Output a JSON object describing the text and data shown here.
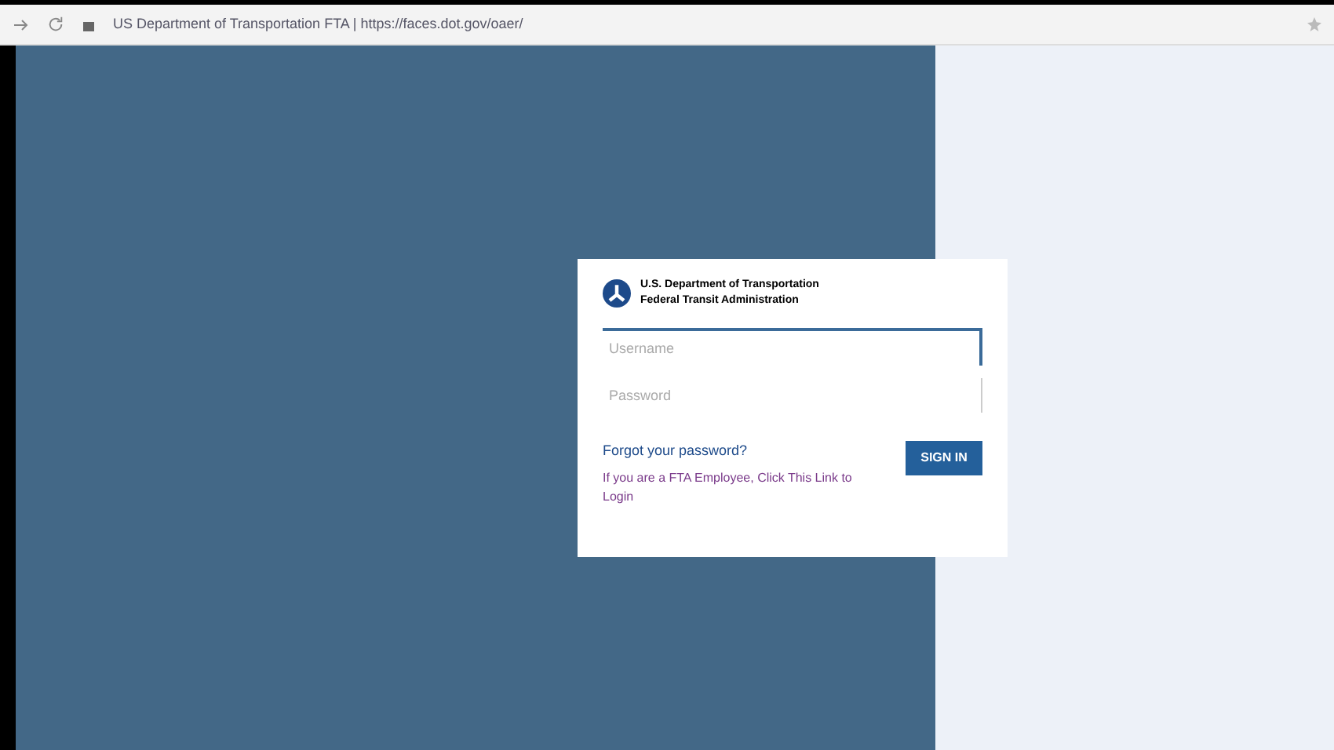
{
  "browser": {
    "address": "US Department of Transportation FTA | https://faces.dot.gov/oaer/"
  },
  "login": {
    "agency": "U.S. Department of Transportation",
    "administration": "Federal Transit Administration",
    "username": {
      "placeholder": "Username"
    },
    "password": {
      "placeholder": "Password"
    },
    "forgot": "Forgot your password?",
    "sign_in": "SIGN IN",
    "employee_link": "If you are a FTA Employee, Click This Link to Login"
  }
}
